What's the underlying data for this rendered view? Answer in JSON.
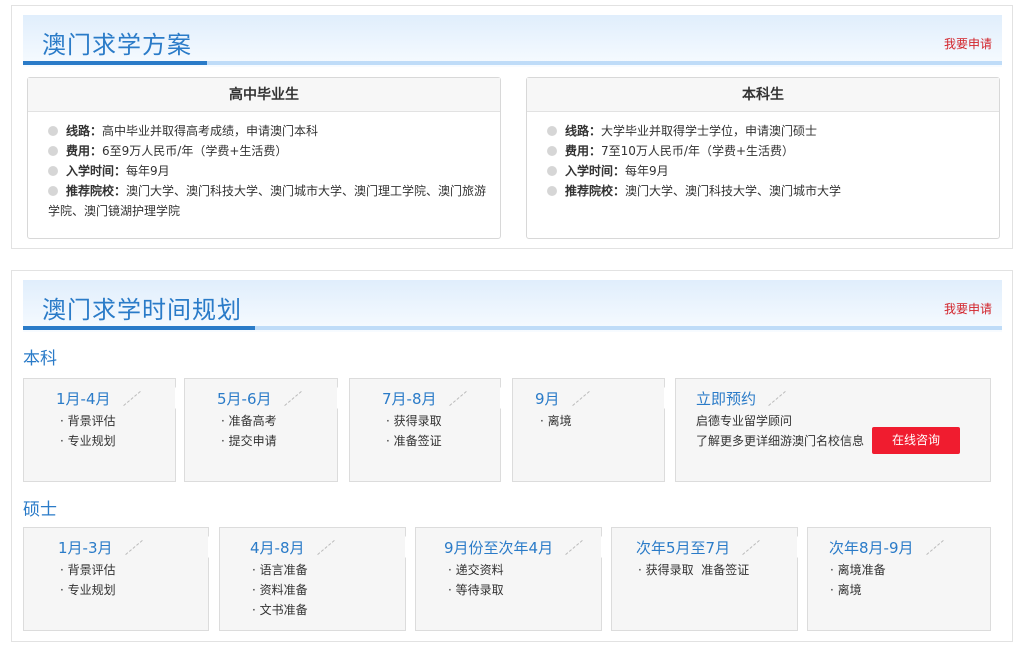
{
  "section1": {
    "title": "澳门求学方案",
    "apply_label": "我要申请",
    "plans": [
      {
        "heading": "高中毕业生",
        "items": [
          {
            "label": "线路：",
            "value": "高中毕业并取得高考成绩，申请澳门本科"
          },
          {
            "label": "费用：",
            "value": "6至9万人民币/年（学费+生活费）"
          },
          {
            "label": "入学时间：",
            "value": "每年9月"
          },
          {
            "label": "推荐院校：",
            "value": "澳门大学、澳门科技大学、澳门城市大学、澳门理工学院、澳门旅游学院、澳门镜湖护理学院"
          }
        ]
      },
      {
        "heading": "本科生",
        "items": [
          {
            "label": "线路：",
            "value": "大学毕业并取得学士学位，申请澳门硕士"
          },
          {
            "label": "费用：",
            "value": "7至10万人民币/年（学费+生活费）"
          },
          {
            "label": "入学时间：",
            "value": "每年9月"
          },
          {
            "label": "推荐院校：",
            "value": "澳门大学、澳门科技大学、澳门城市大学"
          }
        ]
      }
    ]
  },
  "section2": {
    "title": "澳门求学时间规划",
    "apply_label": "我要申请",
    "bachelor": {
      "label": "本科",
      "steps": [
        {
          "title": "1月-4月",
          "items": [
            "背景评估",
            "专业规划"
          ]
        },
        {
          "title": "5月-6月",
          "items": [
            "准备高考",
            "提交申请"
          ]
        },
        {
          "title": "7月-8月",
          "items": [
            "获得录取",
            "准备签证"
          ]
        },
        {
          "title": "9月",
          "items": [
            "离境"
          ]
        }
      ],
      "booking": {
        "title": "立即预约",
        "line1": "启德专业留学顾问",
        "line2": "了解更多更详细游澳门名校信息",
        "button": "在线咨询"
      }
    },
    "master": {
      "label": "硕士",
      "steps": [
        {
          "title": "1月-3月",
          "items": [
            "背景评估",
            "专业规划"
          ]
        },
        {
          "title": "4月-8月",
          "items": [
            "语言准备",
            "资料准备",
            "文书准备"
          ]
        },
        {
          "title": "9月份至次年4月",
          "items": [
            "递交资料",
            "等待录取"
          ]
        },
        {
          "title": "次年5月至7月",
          "items": [
            "获得录取  准备签证"
          ]
        },
        {
          "title": "次年8月-9月",
          "items": [
            "离境准备",
            "离境"
          ]
        }
      ]
    }
  }
}
